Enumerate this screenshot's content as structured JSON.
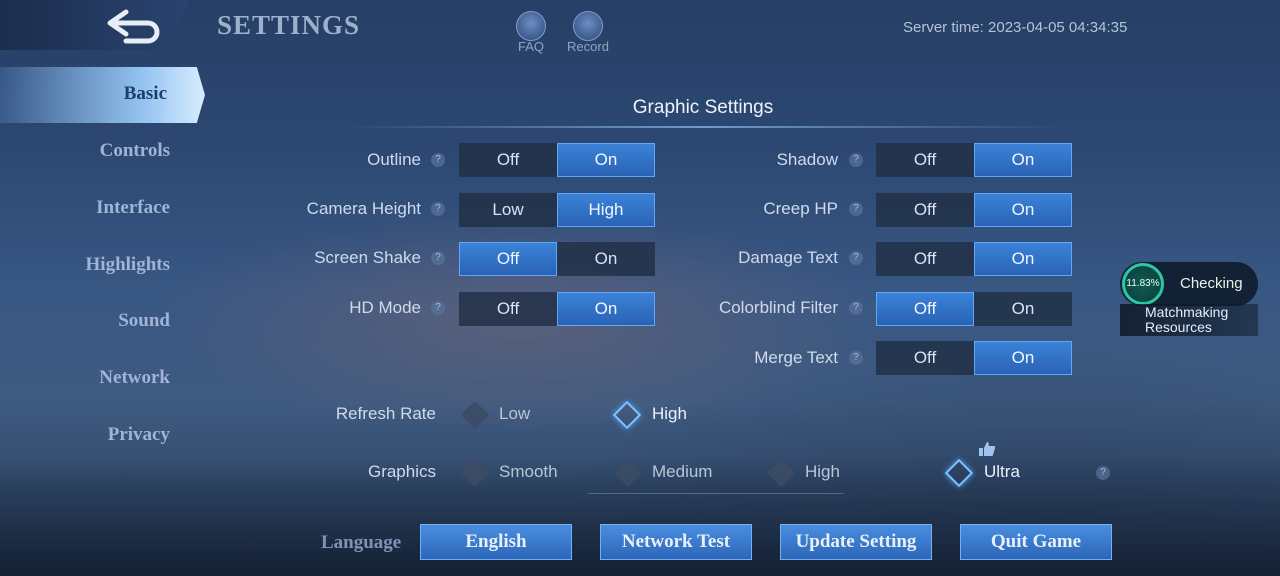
{
  "header": {
    "title": "SETTINGS",
    "faq_label": "FAQ",
    "record_label": "Record",
    "server_time": "Server time: 2023-04-05 04:34:35"
  },
  "sidebar": {
    "items": [
      {
        "label": "Basic",
        "active": true
      },
      {
        "label": "Controls"
      },
      {
        "label": "Interface"
      },
      {
        "label": "Highlights"
      },
      {
        "label": "Sound"
      },
      {
        "label": "Network"
      },
      {
        "label": "Privacy"
      }
    ]
  },
  "graphic": {
    "title": "Graphic Settings",
    "left": [
      {
        "label": "Outline",
        "opt1": "Off",
        "opt2": "On",
        "selected": 2
      },
      {
        "label": "Camera Height",
        "opt1": "Low",
        "opt2": "High",
        "selected": 2
      },
      {
        "label": "Screen Shake",
        "opt1": "Off",
        "opt2": "On",
        "selected": 1
      },
      {
        "label": "HD Mode",
        "opt1": "Off",
        "opt2": "On",
        "selected": 2
      }
    ],
    "right": [
      {
        "label": "Shadow",
        "opt1": "Off",
        "opt2": "On",
        "selected": 2
      },
      {
        "label": "Creep HP",
        "opt1": "Off",
        "opt2": "On",
        "selected": 2
      },
      {
        "label": "Damage Text",
        "opt1": "Off",
        "opt2": "On",
        "selected": 2
      },
      {
        "label": "Colorblind Filter",
        "opt1": "Off",
        "opt2": "On",
        "selected": 1
      },
      {
        "label": "Merge Text",
        "opt1": "Off",
        "opt2": "On",
        "selected": 2
      }
    ],
    "refresh_rate": {
      "label": "Refresh Rate",
      "options": [
        "Low",
        "High"
      ],
      "selected": "High"
    },
    "graphics": {
      "label": "Graphics",
      "options": [
        "Smooth",
        "Medium",
        "High",
        "Ultra"
      ],
      "selected": "Ultra"
    },
    "help_mark": "?"
  },
  "bottom": {
    "language_label": "Language",
    "language_value": "English",
    "network_test": "Network Test",
    "update_setting": "Update Setting",
    "quit_game": "Quit Game"
  },
  "matchmaking": {
    "percent": "11.83%",
    "status": "Checking",
    "line1": "Matchmaking",
    "line2": "Resources"
  },
  "colors": {
    "accent": "#3a82d8",
    "check_ring": "#2ec7a4"
  }
}
